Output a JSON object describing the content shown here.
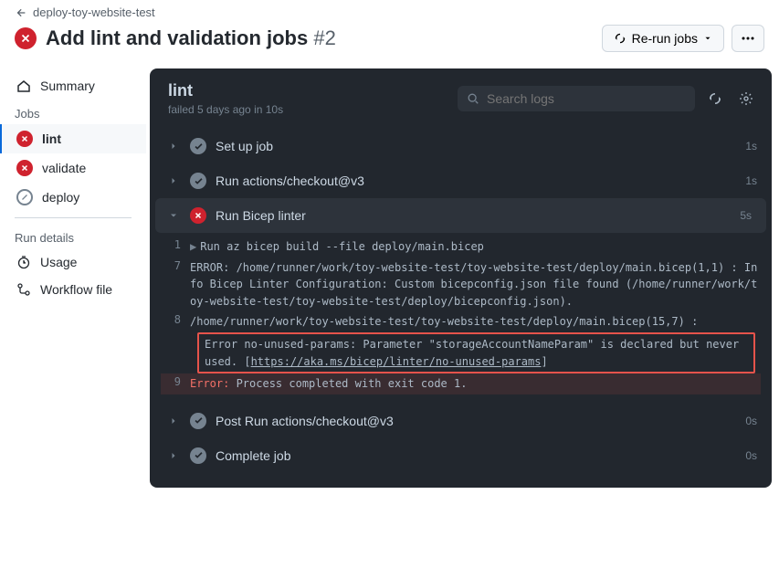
{
  "back": {
    "label": "deploy-toy-website-test"
  },
  "title": {
    "text": "Add lint and validation jobs",
    "number": "#2"
  },
  "actions": {
    "rerun": "Re-run jobs"
  },
  "sidebar": {
    "summary": "Summary",
    "jobs_heading": "Jobs",
    "jobs": [
      {
        "label": "lint",
        "status": "fail",
        "active": true
      },
      {
        "label": "validate",
        "status": "fail",
        "active": false
      },
      {
        "label": "deploy",
        "status": "skip",
        "active": false
      }
    ],
    "run_details_heading": "Run details",
    "usage": "Usage",
    "workflow_file": "Workflow file"
  },
  "job": {
    "name": "lint",
    "status_line": "failed 5 days ago in 10s",
    "search_placeholder": "Search logs"
  },
  "steps": [
    {
      "name": "Set up job",
      "status": "success",
      "time": "1s",
      "expanded": false
    },
    {
      "name": "Run actions/checkout@v3",
      "status": "success",
      "time": "1s",
      "expanded": false
    },
    {
      "name": "Run Bicep linter",
      "status": "fail",
      "time": "5s",
      "expanded": true
    },
    {
      "name": "Post Run actions/checkout@v3",
      "status": "success",
      "time": "0s",
      "expanded": false
    },
    {
      "name": "Complete job",
      "status": "success",
      "time": "0s",
      "expanded": false
    }
  ],
  "logs": {
    "l1_num": "1",
    "l1": "Run az bicep build --file deploy/main.bicep",
    "l7_num": "7",
    "l7": "ERROR: /home/runner/work/toy-website-test/toy-website-test/deploy/main.bicep(1,1) : Info Bicep Linter Configuration: Custom bicepconfig.json file found (/home/runner/work/toy-website-test/toy-website-test/deploy/bicepconfig.json).",
    "l8_num": "8",
    "l8_pre": "/home/runner/work/toy-website-test/toy-website-test/deploy/main.bicep(15,7) : ",
    "l8_err": "Error no-unused-params: Parameter \"storageAccountNameParam\" is declared but never used. [",
    "l8_link": "https://aka.ms/bicep/linter/no-unused-params",
    "l8_post": "]",
    "l9_num": "9",
    "l9_label": "Error:",
    "l9_rest": " Process completed with exit code 1."
  }
}
